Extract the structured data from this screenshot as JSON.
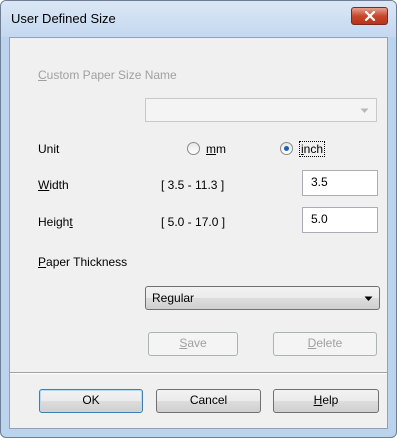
{
  "window": {
    "title": "User Defined Size"
  },
  "custom_name": {
    "label": "Custom Paper Size Name",
    "value": ""
  },
  "unit": {
    "label": "Unit",
    "options": [
      {
        "label": "mm",
        "selected": false
      },
      {
        "label": "inch",
        "selected": true
      }
    ]
  },
  "width": {
    "label": "Width",
    "range": "[ 3.5 - 11.3 ]",
    "value": "3.5"
  },
  "height": {
    "label": "Height",
    "range": "[ 5.0 - 17.0 ]",
    "value": "5.0"
  },
  "thickness": {
    "label": "Paper Thickness",
    "selected": "Regular"
  },
  "buttons": {
    "save": "Save",
    "delete": "Delete",
    "ok": "OK",
    "cancel": "Cancel",
    "help": "Help"
  },
  "icons": {
    "close": "close-icon",
    "dropdown": "chevron-down-icon"
  },
  "colors": {
    "accent": "#1c5fb5",
    "close_button": "#c7472d"
  }
}
